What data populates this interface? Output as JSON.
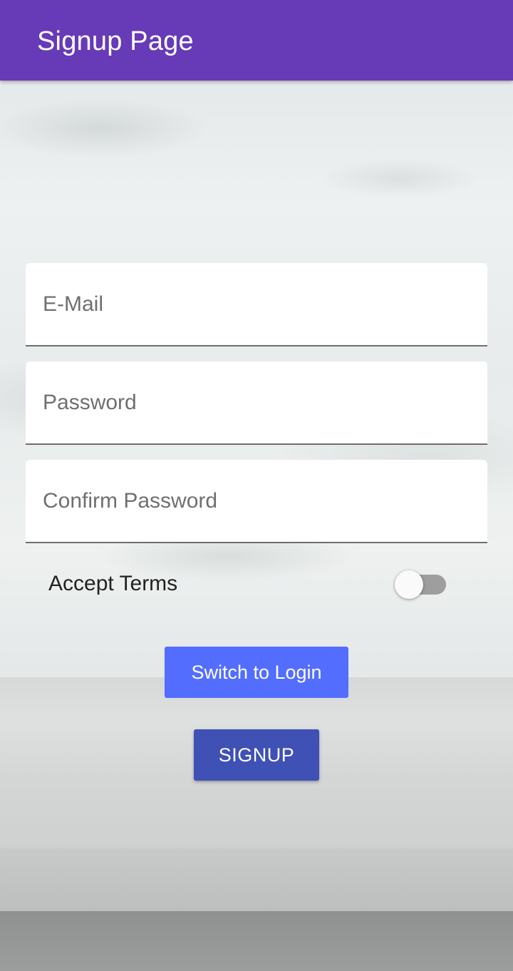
{
  "app_bar": {
    "title": "Signup Page",
    "color": "#673ab7"
  },
  "form": {
    "email": {
      "placeholder": "E-Mail",
      "value": ""
    },
    "password": {
      "placeholder": "Password",
      "value": ""
    },
    "confirm_password": {
      "placeholder": "Confirm Password",
      "value": ""
    },
    "terms": {
      "label": "Accept Terms",
      "accepted": false
    }
  },
  "actions": {
    "switch_label": "Switch to Login",
    "switch_color": "#536dfe",
    "signup_label": "SIGNUP",
    "signup_color": "#3f51b5"
  }
}
